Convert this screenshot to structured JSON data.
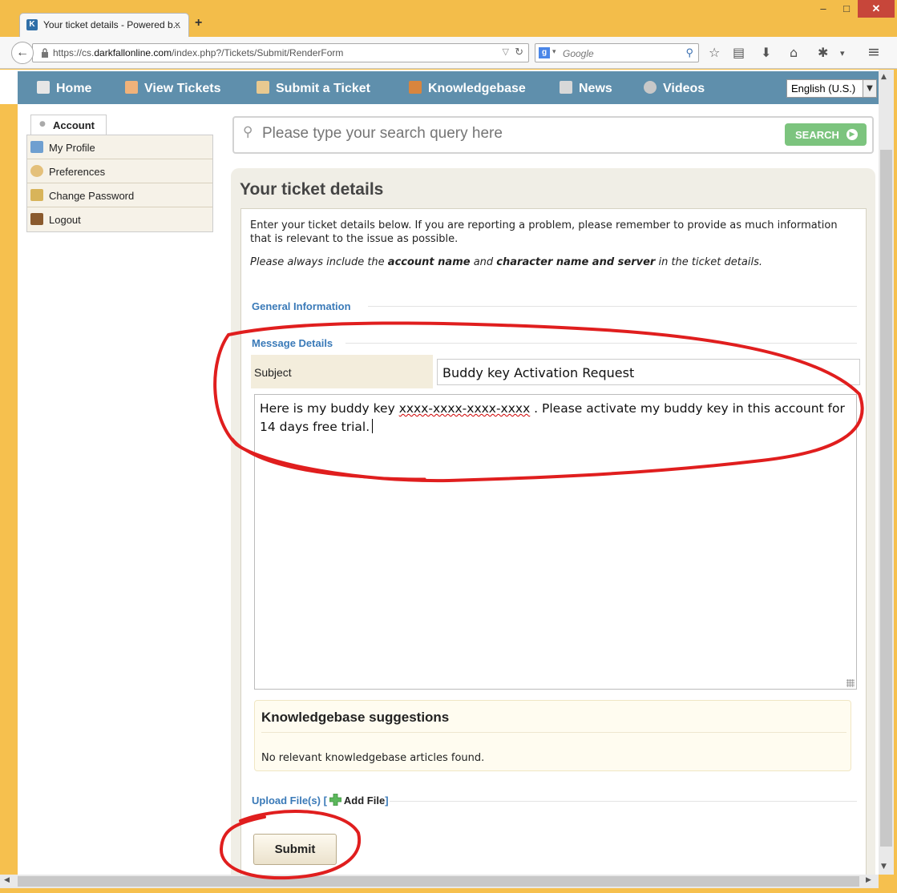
{
  "browser": {
    "tab_title": "Your ticket details - Powered b...",
    "tab_close": "×",
    "new_tab": "+",
    "win_min": "–",
    "win_max": "□",
    "win_close": "✕",
    "url_prefix": "https://cs.",
    "url_domain": "darkfallonline.com",
    "url_path": "/index.php?/Tickets/Submit/RenderForm",
    "search_engine_placeholder": "Google",
    "search_engine_letter": "g",
    "favicon_letter": "K"
  },
  "site_nav": {
    "items": [
      {
        "label": "Home",
        "icon": "home-icon"
      },
      {
        "label": "View Tickets",
        "icon": "tickets-icon"
      },
      {
        "label": "Submit a Ticket",
        "icon": "submit-ticket-icon"
      },
      {
        "label": "Knowledgebase",
        "icon": "book-icon"
      },
      {
        "label": "News",
        "icon": "news-icon"
      },
      {
        "label": "Videos",
        "icon": "video-icon"
      }
    ],
    "language": "English (U.S.)"
  },
  "sidebar": {
    "tab_label": "Account",
    "items": [
      {
        "label": "My Profile",
        "icon": "profile-icon"
      },
      {
        "label": "Preferences",
        "icon": "preferences-gear-icon"
      },
      {
        "label": "Change Password",
        "icon": "lock-icon"
      },
      {
        "label": "Logout",
        "icon": "logout-door-icon"
      }
    ]
  },
  "search": {
    "placeholder": "Please type your search query here",
    "button_label": "SEARCH"
  },
  "ticket": {
    "heading": "Your ticket details",
    "intro": "Enter your ticket details below. If you are reporting a problem, please remember to provide as much information that is relevant to the issue as possible.",
    "note_prefix": "Please always include the ",
    "note_b1": "account name",
    "note_mid": " and ",
    "note_b2": "character name and server",
    "note_suffix": " in the ticket details.",
    "section_general": "General Information",
    "section_message": "Message Details",
    "subject_label": "Subject",
    "subject_value": "Buddy key Activation Request",
    "message_prefix": "Here is my buddy key ",
    "message_key": "xxxx-xxxx-xxxx-xxxx",
    "message_suffix": " .  Please activate my buddy key in this account for 14 days free trial.",
    "kb_title": "Knowledgebase suggestions",
    "kb_text": "No relevant knowledgebase articles found.",
    "upload_label": "Upload File(s)",
    "upload_bracket_open": " [",
    "add_file_label": "Add File",
    "upload_bracket_close": "]",
    "submit_label": "Submit"
  },
  "colors": {
    "nav_bg": "#5f8fac",
    "section_blue": "#3a7ab8",
    "search_green": "#7cc47e",
    "annotation_red": "#e01e1e"
  }
}
